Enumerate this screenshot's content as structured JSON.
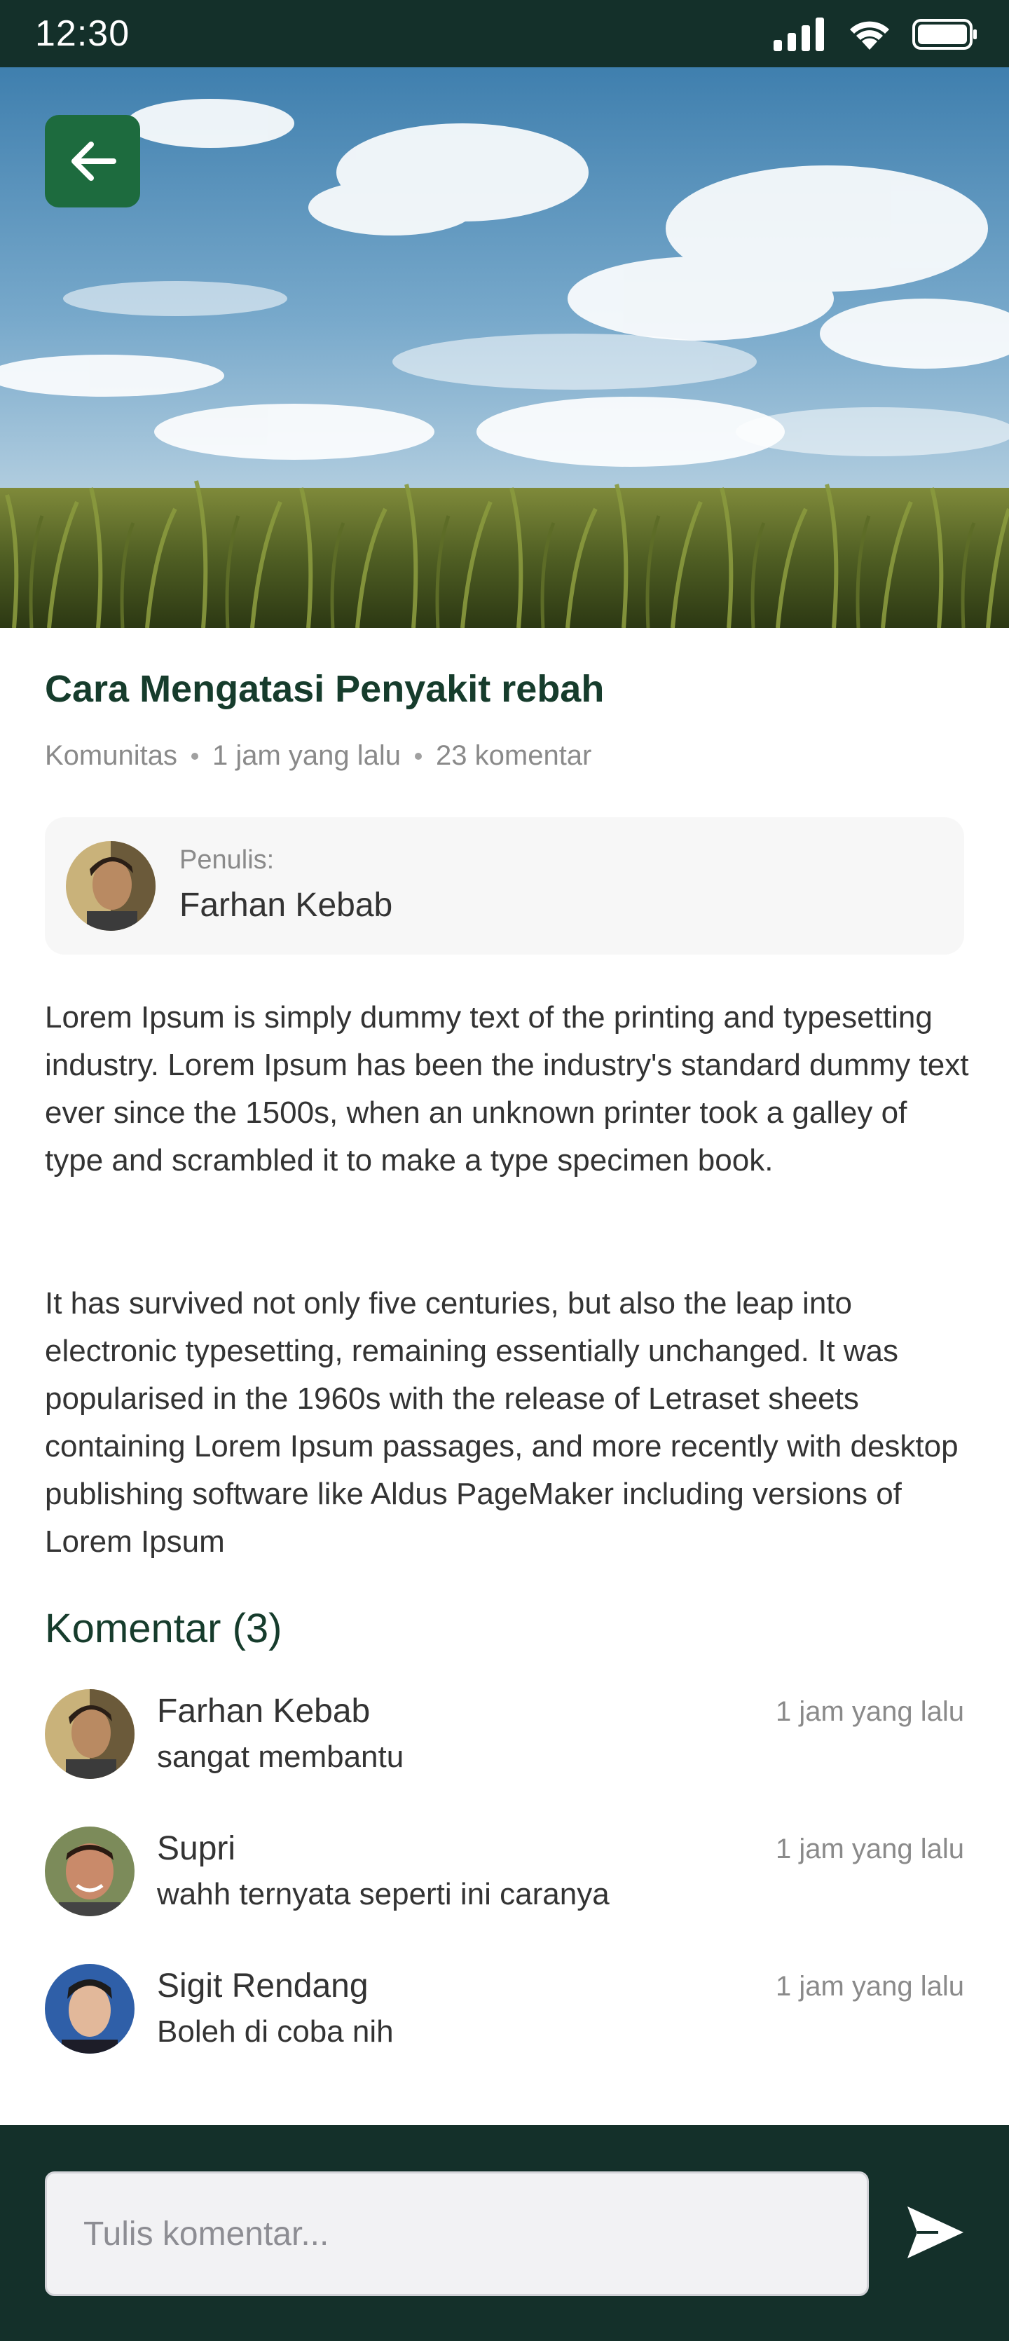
{
  "status_bar": {
    "time": "12:30",
    "icons": [
      "signal-icon",
      "wifi-icon",
      "battery-icon"
    ]
  },
  "hero": {
    "image": "cornfield-under-cloudy-sky",
    "back_icon": "arrow-left-icon"
  },
  "article": {
    "title": "Cara Mengatasi Penyakit rebah",
    "category": "Komunitas",
    "time": "1 jam yang lalu",
    "comments_count": "23 komentar",
    "author_label": "Penulis:",
    "author_name": "Farhan Kebab",
    "paragraphs": [
      "Lorem Ipsum is simply dummy text of the printing and typesetting industry. Lorem Ipsum has been the industry's standard dummy text ever since the 1500s, when an unknown printer took a galley of type and scrambled it to make a type specimen book.",
      "It has survived not only five centuries, but also the leap into electronic typesetting, remaining essentially unchanged. It was popularised in the 1960s with the release of Letraset sheets containing Lorem Ipsum passages, and more recently with desktop publishing software like Aldus PageMaker including versions of Lorem Ipsum"
    ]
  },
  "comments": {
    "title": "Komentar (3)",
    "items": [
      {
        "name": "Farhan Kebab",
        "time": "1 jam yang lalu",
        "text": "sangat membantu"
      },
      {
        "name": "Supri",
        "time": "1 jam yang lalu",
        "text": "wahh ternyata seperti ini caranya"
      },
      {
        "name": "Sigit Rendang",
        "time": "1 jam yang lalu",
        "text": "Boleh di coba nih"
      }
    ]
  },
  "composer": {
    "placeholder": "Tulis komentar...",
    "send_icon": "send-icon"
  },
  "colors": {
    "dark_green": "#14302a",
    "accent_green": "#1d6b3e",
    "title_green": "#163c2c"
  }
}
